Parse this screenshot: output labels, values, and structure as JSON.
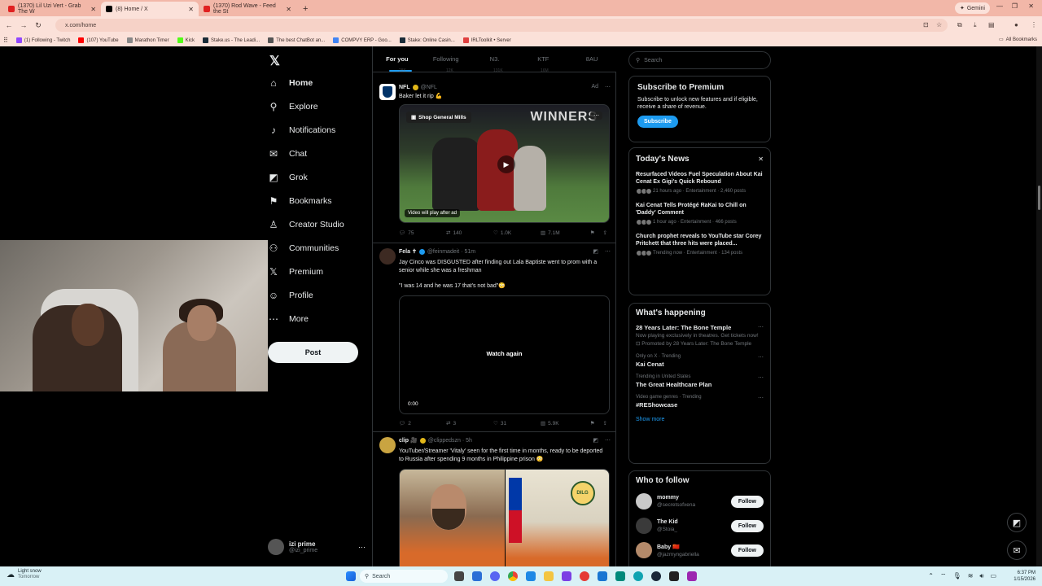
{
  "browser": {
    "tabs": [
      {
        "title": "(1370) Lil Uzi Vert - Grab The W",
        "color": "#e02020",
        "active": false
      },
      {
        "title": "(8) Home / X",
        "color": "#000000",
        "active": true
      },
      {
        "title": "(1370) Rod Wave - Feed the St",
        "color": "#e02020",
        "active": false
      }
    ],
    "new_tab": "+",
    "gemini_label": "Gemini",
    "url": "x.com/home",
    "bookmarks": [
      {
        "label": "(1) Following - Twitch",
        "color": "#9146ff"
      },
      {
        "label": "(107) YouTube",
        "color": "#ff0000"
      },
      {
        "label": "Marathon Timer",
        "color": "#888888"
      },
      {
        "label": "Kick",
        "color": "#53fc18"
      },
      {
        "label": "Stake.us - The Leadi...",
        "color": "#1a2c38"
      },
      {
        "label": "The best ChatBot an...",
        "color": "#555555"
      },
      {
        "label": "COMPVY ERP - Goo...",
        "color": "#4285f4"
      },
      {
        "label": "Stake: Online Casin...",
        "color": "#1a2c38"
      },
      {
        "label": "IRLToolkit • Server",
        "color": "#e04040"
      }
    ],
    "all_bookmarks": "All Bookmarks"
  },
  "nav": {
    "items": [
      {
        "label": "Home",
        "icon": "home-icon",
        "glyph": "⌂"
      },
      {
        "label": "Explore",
        "icon": "search-icon",
        "glyph": "⚲"
      },
      {
        "label": "Notifications",
        "icon": "bell-icon",
        "glyph": "🔔︎"
      },
      {
        "label": "Chat",
        "icon": "mail-icon",
        "glyph": "✉"
      },
      {
        "label": "Grok",
        "icon": "grok-icon",
        "glyph": "◩"
      },
      {
        "label": "Bookmarks",
        "icon": "bookmark-icon",
        "glyph": "⚑"
      },
      {
        "label": "Creator Studio",
        "icon": "creator-icon",
        "glyph": "♙"
      },
      {
        "label": "Communities",
        "icon": "people-icon",
        "glyph": "⚇"
      },
      {
        "label": "Premium",
        "icon": "x-icon",
        "glyph": "𝕏"
      },
      {
        "label": "Profile",
        "icon": "person-icon",
        "glyph": "☺"
      },
      {
        "label": "More",
        "icon": "more-icon",
        "glyph": "⋯"
      }
    ],
    "post_label": "Post",
    "profile": {
      "name": "izi prime",
      "handle": "@izi_prime"
    }
  },
  "feed": {
    "tabs": [
      "For you",
      "Following",
      "N3.",
      "KTF",
      "8AU"
    ],
    "top_stats": [
      "28K",
      "12K",
      "131K",
      "16M"
    ],
    "tweets": [
      {
        "name": "NFL",
        "handle": "@NFL",
        "time": "",
        "ad": "Ad",
        "text": "Baker let it rip 💪",
        "media_badge": "Shop General Mills",
        "media_note": "Video will play after ad",
        "media_banner": "WINNERS",
        "stats": {
          "replies": "75",
          "reposts": "140",
          "likes": "1.0K",
          "views": "7.1M"
        }
      },
      {
        "name": "Fela ✝",
        "handle": "@feinmadeit · 51m",
        "time": "",
        "text": "Jay Cinco was DISGUSTED after finding out Lala Baptiste went to prom with a senior while she was a freshman",
        "text2": "\"I was 14 and he was 17 that's not bad\"😳",
        "media_center": "Watch again",
        "media_time": "0:00",
        "stats": {
          "replies": "2",
          "reposts": "3",
          "likes": "31",
          "views": "5.9K"
        }
      },
      {
        "name": "clip 🎥",
        "handle": "@clippedszn · 5h",
        "time": "",
        "text": "YouTuber/Streamer 'Vitaly' seen for the first time in months, ready to be deported to Russia after spending 9 months in Philippine prison 😳",
        "media_label": "DILG"
      }
    ]
  },
  "right": {
    "search_placeholder": "Search",
    "premium": {
      "title": "Subscribe to Premium",
      "body": "Subscribe to unlock new features and if eligible, receive a share of revenue.",
      "button": "Subscribe"
    },
    "news": {
      "title": "Today's News",
      "close": "✕",
      "items": [
        {
          "title": "Resurfaced Videos Fuel Speculation About Kai Cenat Ex Gigi's Quick Rebound",
          "meta": "21 hours ago · Entertainment · 2,460 posts"
        },
        {
          "title": "Kai Cenat Tells Protégé RaKai to Chill on 'Daddy' Comment",
          "meta": "1 hour ago · Entertainment · 466 posts"
        },
        {
          "title": "Church prophet reveals to YouTube star Corey Pritchett that three hits were placed...",
          "meta": "Trending now · Entertainment · 134 posts"
        }
      ]
    },
    "happening": {
      "title": "What's happening",
      "items": [
        {
          "context": "",
          "title": "28 Years Later: The Bone Temple",
          "desc": "Now playing exclusively in theatres. Get tickets now!",
          "promo": "Promoted by 28 Years Later: The Bone Temple"
        },
        {
          "context": "Only on X · Trending",
          "title": "Kai Cenat",
          "desc": "",
          "promo": ""
        },
        {
          "context": "Trending in United States",
          "title": "The Great Healthcare Plan",
          "desc": "",
          "promo": ""
        },
        {
          "context": "Video game genres · Trending",
          "title": "#REShowcase",
          "desc": "",
          "promo": ""
        }
      ],
      "show_more": "Show more"
    },
    "who_to_follow": {
      "title": "Who to follow",
      "follow_label": "Follow",
      "accounts": [
        {
          "name": "mommy",
          "handle": "@secretsofxena",
          "color": "#c9c9c9"
        },
        {
          "name": "The Kid",
          "handle": "@Stoia_",
          "color": "#3a3a3a"
        },
        {
          "name": "Baby 🇨🇳",
          "handle": "@jazmyngabriella",
          "color": "#b48a6a"
        }
      ]
    }
  },
  "taskbar": {
    "weather_main": "Light snow",
    "weather_sub": "Tomorrow",
    "search": "Search",
    "time": "6:37 PM",
    "date": "1/15/2026"
  }
}
